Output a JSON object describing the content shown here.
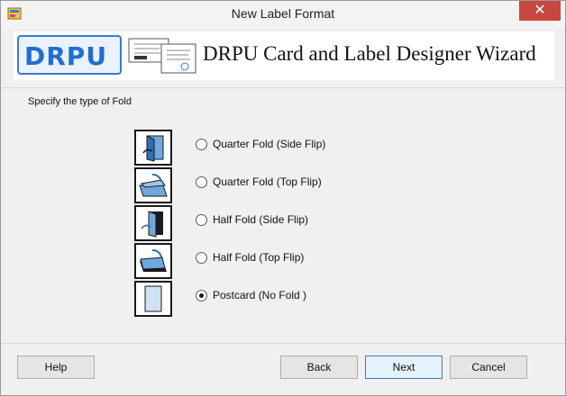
{
  "window": {
    "title": "New Label Format",
    "close_symbol": "✕",
    "icons": {
      "app": "app-icon",
      "close": "close-icon"
    }
  },
  "banner": {
    "logo_text": "DRPU",
    "heading": "DRPU Card and Label Designer Wizard",
    "art": "label-cards-illustration"
  },
  "content": {
    "prompt": "Specify the type  of Fold",
    "options": [
      {
        "label": "Quarter Fold (Side Flip)",
        "icon": "quarter-fold-side-icon",
        "selected": false
      },
      {
        "label": "Quarter Fold (Top Flip)",
        "icon": "quarter-fold-top-icon",
        "selected": false
      },
      {
        "label": "Half Fold (Side Flip)",
        "icon": "half-fold-side-icon",
        "selected": false
      },
      {
        "label": "Half Fold (Top Flip)",
        "icon": "half-fold-top-icon",
        "selected": false
      },
      {
        "label": "Postcard (No Fold )",
        "icon": "postcard-icon",
        "selected": true
      }
    ]
  },
  "footer": {
    "help": "Help",
    "back": "Back",
    "next": "Next",
    "cancel": "Cancel"
  },
  "colors": {
    "accent": "#1f6fd1",
    "close_button": "#c7483f",
    "primary_button_border": "#3c7fb1"
  }
}
